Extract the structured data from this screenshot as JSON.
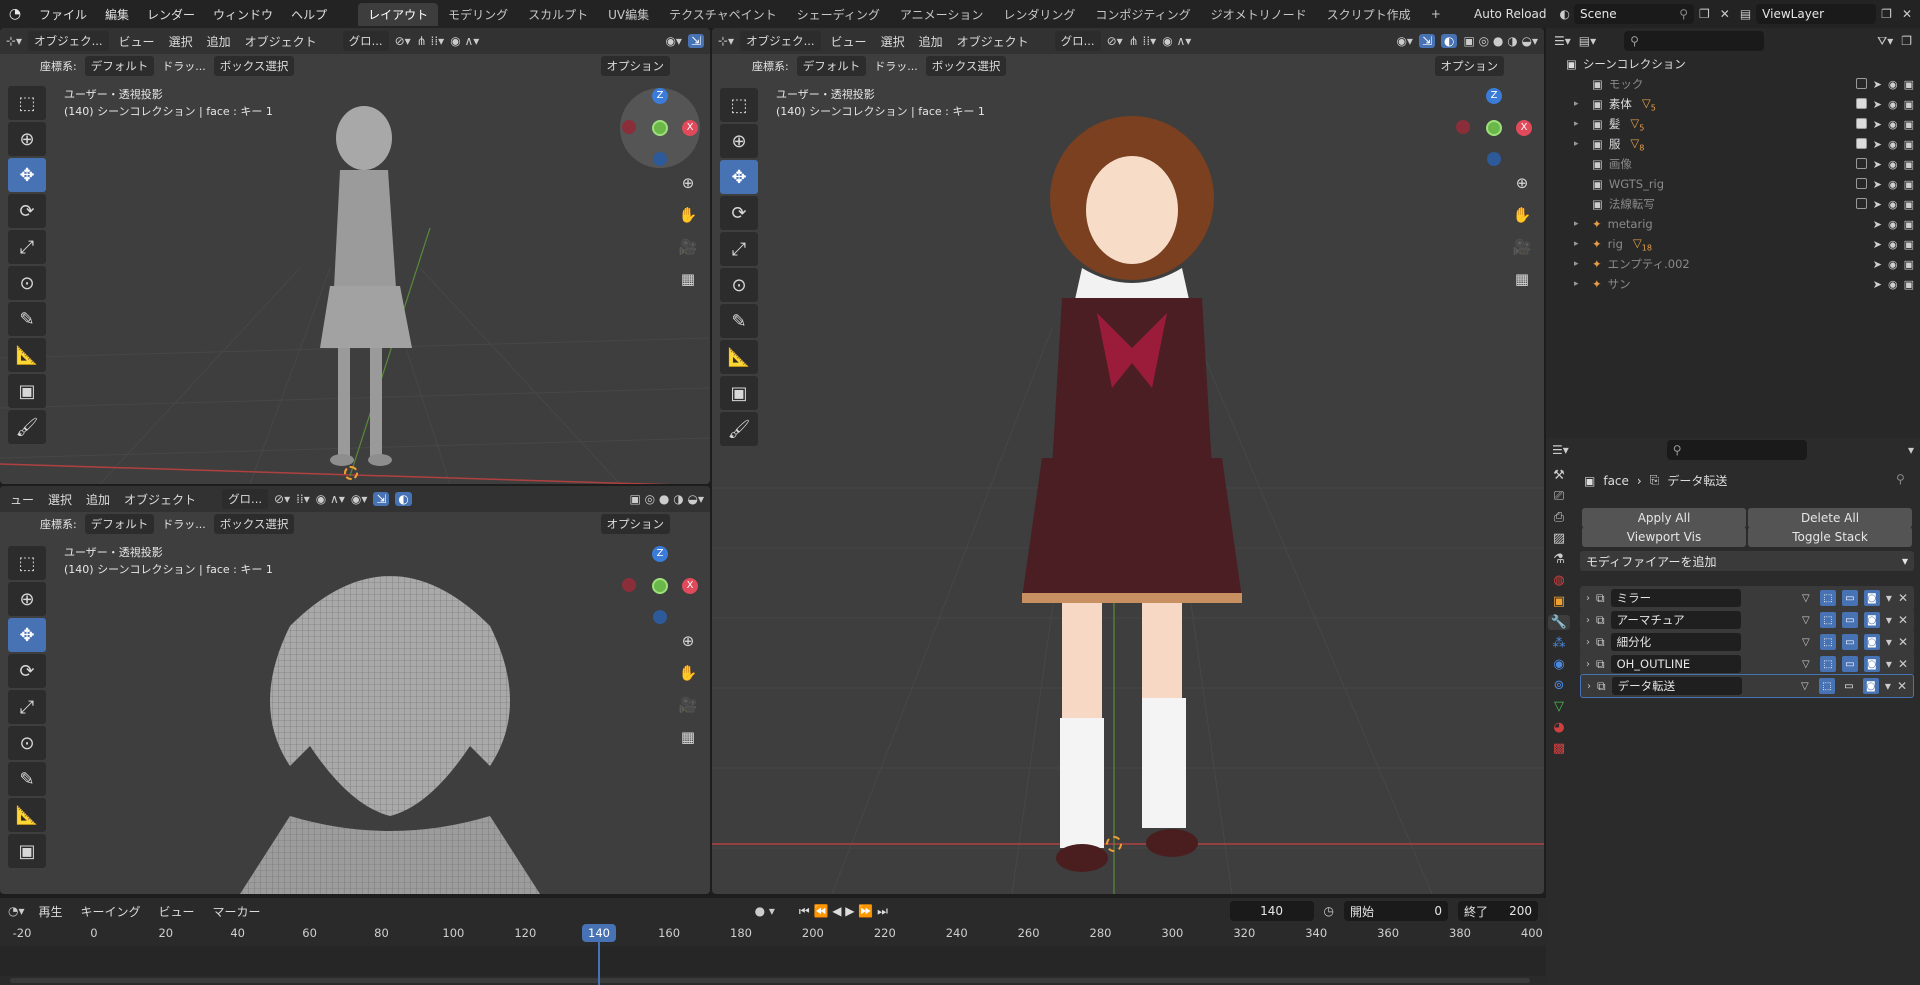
{
  "topbar": {
    "menus": [
      "ファイル",
      "編集",
      "レンダー",
      "ウィンドウ",
      "ヘルプ"
    ],
    "workspaces": [
      "レイアウト",
      "モデリング",
      "スカルプト",
      "UV編集",
      "テクスチャペイント",
      "シェーディング",
      "アニメーション",
      "レンダリング",
      "コンポジティング",
      "ジオメトリノード",
      "スクリプト作成"
    ],
    "active_workspace": "レイアウト",
    "auto_reload": "Auto Reload",
    "scene": "Scene",
    "view_layer": "ViewLayer"
  },
  "viewport_common": {
    "mode": "オブジェク...",
    "view": "ビュー",
    "select": "選択",
    "add": "追加",
    "object": "オブジェクト",
    "orient": "グロ...",
    "coord_label": "座標系:",
    "coord_value": "デフォルト",
    "drag": "ドラッ...",
    "box": "ボックス選択",
    "options": "オプション",
    "projection": "ユーザー・透視投影",
    "info": "(140) シーンコレクション | face : キー 1"
  },
  "bottomleft_header": {
    "view": "ュー",
    "select": "選択",
    "add": "追加",
    "object": "オブジェクト"
  },
  "outliner": {
    "root": "シーンコレクション",
    "rows": [
      {
        "name": "モック",
        "dim": true
      },
      {
        "name": "素体",
        "badge": "5"
      },
      {
        "name": "髪",
        "badge": "5"
      },
      {
        "name": "服",
        "badge": "8"
      },
      {
        "name": "画像",
        "dim": true
      },
      {
        "name": "WGTS_rig",
        "dim": true
      },
      {
        "name": "法線転写",
        "dim": true
      },
      {
        "name": "metarig",
        "dim": true
      },
      {
        "name": "rig",
        "dim": true,
        "badge": "18"
      },
      {
        "name": "エンプティ.002",
        "dim": true
      },
      {
        "name": "サン",
        "dim": true
      }
    ]
  },
  "properties": {
    "crumb_obj": "face",
    "crumb_mod": "データ転送",
    "apply_all": "Apply All",
    "delete_all": "Delete All",
    "viewport_vis": "Viewport Vis",
    "toggle_stack": "Toggle Stack",
    "add_modifier": "モディファイアーを追加",
    "modifiers": [
      "ミラー",
      "アーマチュア",
      "細分化",
      "OH_OUTLINE",
      "データ転送"
    ]
  },
  "timeline": {
    "play": "再生",
    "keying": "キーイング",
    "view": "ビュー",
    "marker": "マーカー",
    "current": "140",
    "start_label": "開始",
    "start": "0",
    "end_label": "終了",
    "end": "200",
    "ticks": [
      "-20",
      "0",
      "20",
      "40",
      "60",
      "80",
      "100",
      "120",
      "140",
      "160",
      "180",
      "200",
      "220",
      "240",
      "260",
      "280",
      "300",
      "320",
      "340",
      "360",
      "380",
      "400"
    ]
  }
}
